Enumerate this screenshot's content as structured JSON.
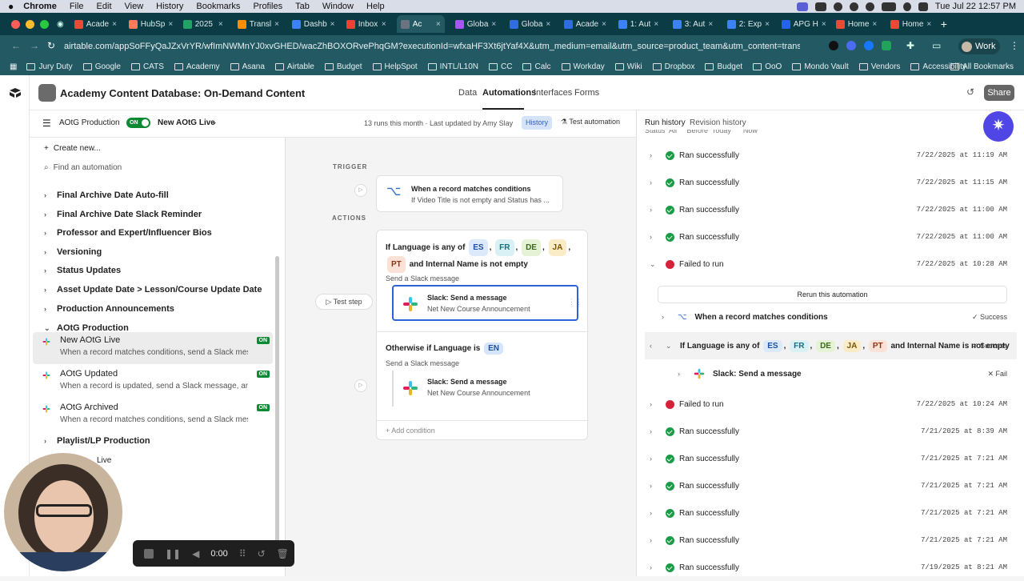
{
  "macbar": {
    "app": "Chrome",
    "menus": [
      "File",
      "Edit",
      "View",
      "History",
      "Bookmarks",
      "Profiles",
      "Tab",
      "Window",
      "Help"
    ],
    "clock": "Tue Jul 22  12:57 PM"
  },
  "tabs": [
    {
      "label": "Acade",
      "color": "#e94b35"
    },
    {
      "label": "HubSp",
      "color": "#ff7a59"
    },
    {
      "label": "2025",
      "color": "#21a366"
    },
    {
      "label": "Transl",
      "color": "#ff8f00"
    },
    {
      "label": "Dashb",
      "color": "#3b82f6"
    },
    {
      "label": "Inbox",
      "color": "#ea4335"
    },
    {
      "label": "Ac",
      "color": "#6b7280",
      "active": true
    },
    {
      "label": "Globa",
      "color": "#a855f7"
    },
    {
      "label": "Globa",
      "color": "#2f6de1"
    },
    {
      "label": "Acade",
      "color": "#2f6de1"
    },
    {
      "label": "1: Aut",
      "color": "#3b82f6"
    },
    {
      "label": "3: Aut",
      "color": "#3b82f6"
    },
    {
      "label": "2: Exp",
      "color": "#3b82f6"
    },
    {
      "label": "APG H",
      "color": "#2563eb"
    },
    {
      "label": "Home",
      "color": "#e94b35"
    },
    {
      "label": "Home",
      "color": "#e94b35"
    }
  ],
  "address": {
    "url": "airtable.com/appSoFFyQaJZxVrYR/wfImNWMnYJ0xvGHED/wacZhBOXORvePhqGM?executionId=wfxaHF3Xt6jtYaf4X&utm_medium=email&utm_source=product_team&utm_content=transactional-aler...",
    "profile": "Work"
  },
  "bookmarks": [
    "Jury Duty",
    "Google",
    "CATS",
    "Academy",
    "Asana",
    "Airtable",
    "Budget",
    "HelpSpot",
    "INTL/L10N",
    "CC",
    "Calc",
    "Workday",
    "Wiki",
    "Dropbox",
    "Budget",
    "OoO",
    "Mondo Vault",
    "Vendors",
    "Accessibility"
  ],
  "bookmarks_all": "All Bookmarks",
  "base": {
    "title": "Academy Content Database: On-Demand Content",
    "nav": [
      "Data",
      "Automations",
      "Interfaces",
      "Forms"
    ],
    "share": "Share"
  },
  "toolbar": {
    "group": "AOtG Production",
    "toggle": "ON",
    "automation": "New AOtG Live",
    "runs": "13 runs this month · Last updated by Amy Slay",
    "history": "History",
    "test": "Test automation"
  },
  "sidebar": {
    "create": "Create new...",
    "find": "Find an automation",
    "items": [
      "Final Archive Date Auto-fill",
      "Final Archive Date Slack Reminder",
      "Professor and Expert/Influencer Bios",
      "Versioning",
      "Status Updates",
      "Asset Update Date > Lesson/Course Update Date",
      "Production Announcements",
      "AOtG Production"
    ],
    "automations": [
      {
        "title": "New AOtG Live",
        "desc": "When a record matches conditions, send a Slack messa...",
        "badge": "ON"
      },
      {
        "title": "AOtG Updated",
        "desc": "When a record is updated, send a Slack message, and 1 ...",
        "badge": "ON"
      },
      {
        "title": "AOtG Archived",
        "desc": "When a record matches conditions, send a Slack messa...",
        "badge": "ON"
      }
    ],
    "more": [
      "Playlist/LP Production",
      "Live"
    ]
  },
  "canvas": {
    "trigger_label": "TRIGGER",
    "actions_label": "ACTIONS",
    "trigger_title": "When a record matches conditions",
    "trigger_desc": "If Video Title is not empty and Status has ...",
    "if_prefix": "If Language is any of",
    "langs": [
      "ES",
      "FR",
      "DE",
      "JA",
      "PT"
    ],
    "if_suffix": "and Internal Name is not empty",
    "send": "Send a Slack message",
    "slack_title": "Slack: Send a message",
    "slack_desc": "Net New Course Announcement",
    "test_step": "Test step",
    "otherwise": "Otherwise if Language is",
    "otherwise_lang": "EN",
    "add_condition": "Add condition"
  },
  "rpanel": {
    "tabs": [
      "Run history",
      "Revision history"
    ],
    "filters": "Status  All     Before  Today      Now",
    "runs_top": [
      {
        "status": "Ran successfully",
        "date": "7/22/2025 at 11:19 AM"
      },
      {
        "status": "Ran successfully",
        "date": "7/22/2025 at 11:15 AM"
      },
      {
        "status": "Ran successfully",
        "date": "7/22/2025 at 11:00 AM"
      },
      {
        "status": "Ran successfully",
        "date": "7/22/2025 at 11:00 AM"
      }
    ],
    "failed": {
      "status": "Failed to run",
      "date": "7/22/2025 at 10:28 AM",
      "rerun": "Rerun this automation",
      "step1": "When a record matches conditions",
      "step1_status": "Success",
      "step2_prefix": "If Language is any of",
      "step2_suffix": "and Internal Name is not empty",
      "step2_status": "Success",
      "step3": "Slack: Send a message",
      "step3_status": "Fail"
    },
    "runs_bottom": [
      {
        "status": "Failed to run",
        "date": "7/22/2025 at 10:24 AM",
        "fail": true
      },
      {
        "status": "Ran successfully",
        "date": "7/21/2025 at 8:39 AM"
      },
      {
        "status": "Ran successfully",
        "date": "7/21/2025 at 7:21 AM"
      },
      {
        "status": "Ran successfully",
        "date": "7/21/2025 at 7:21 AM"
      },
      {
        "status": "Ran successfully",
        "date": "7/21/2025 at 7:21 AM"
      },
      {
        "status": "Ran successfully",
        "date": "7/21/2025 at 7:21 AM"
      },
      {
        "status": "Ran successfully",
        "date": "7/19/2025 at 8:21 AM"
      }
    ]
  },
  "recorder": {
    "time": "0:00"
  }
}
